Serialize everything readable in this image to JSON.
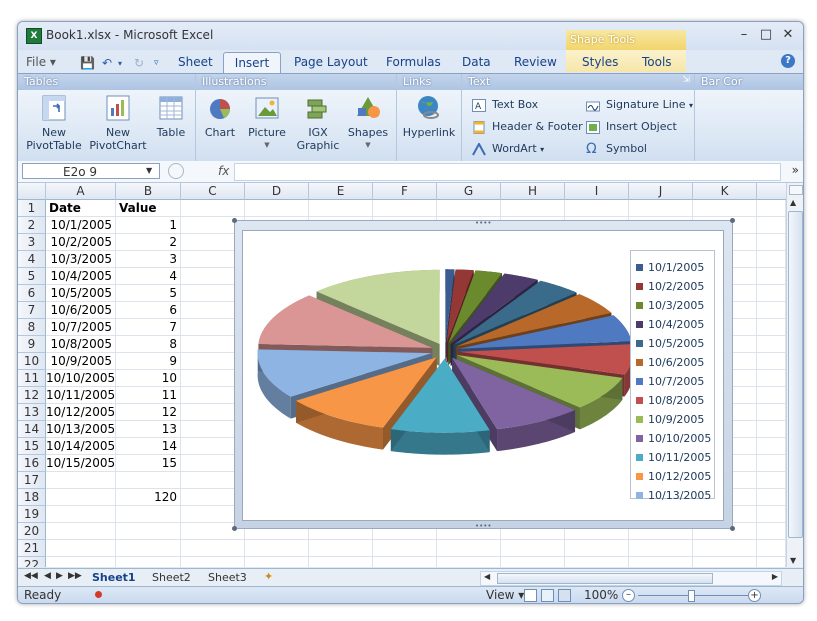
{
  "window": {
    "title": "Book1.xlsx - Microsoft Excel"
  },
  "context_tab_group": "Shape Tools",
  "tabs": [
    {
      "label": "File",
      "active": false
    },
    {
      "label": "Sheet",
      "active": false
    },
    {
      "label": "Insert",
      "active": true
    },
    {
      "label": "Page Layout",
      "active": false
    },
    {
      "label": "Formulas",
      "active": false
    },
    {
      "label": "Data",
      "active": false
    },
    {
      "label": "Review",
      "active": false
    },
    {
      "label": "Styles",
      "active": false
    },
    {
      "label": "Tools",
      "active": false
    }
  ],
  "ribbon": {
    "groups": {
      "tables": "Tables",
      "illustrations": "Illustrations",
      "links": "Links",
      "text": "Text",
      "bar_cor": "Bar Cor"
    },
    "buttons": {
      "new_pivottable": "New\nPivotTable",
      "new_pivotchart": "New\nPivotChart",
      "table": "Table",
      "chart": "Chart",
      "picture": "Picture",
      "igx_graphic": "IGX\nGraphic",
      "shapes": "Shapes",
      "hyperlink": "Hyperlink",
      "text_box": "Text Box",
      "header_footer": "Header & Footer",
      "wordart": "WordArt",
      "signature_line": "Signature Line",
      "insert_object": "Insert Object",
      "symbol": "Symbol"
    }
  },
  "formula_bar": {
    "name_box": "E2o 9",
    "fx": "fx",
    "formula": ""
  },
  "columns": [
    "A",
    "B",
    "C",
    "D",
    "E",
    "F",
    "G",
    "H",
    "I",
    "J",
    "K"
  ],
  "rows": [
    {
      "n": "1",
      "a": "Date",
      "b": "Value",
      "bold": true
    },
    {
      "n": "2",
      "a": "10/1/2005",
      "b": "1"
    },
    {
      "n": "3",
      "a": "10/2/2005",
      "b": "2"
    },
    {
      "n": "4",
      "a": "10/3/2005",
      "b": "3"
    },
    {
      "n": "5",
      "a": "10/4/2005",
      "b": "4"
    },
    {
      "n": "6",
      "a": "10/5/2005",
      "b": "5"
    },
    {
      "n": "7",
      "a": "10/6/2005",
      "b": "6"
    },
    {
      "n": "8",
      "a": "10/7/2005",
      "b": "7"
    },
    {
      "n": "9",
      "a": "10/8/2005",
      "b": "8"
    },
    {
      "n": "10",
      "a": "10/9/2005",
      "b": "9"
    },
    {
      "n": "11",
      "a": "10/10/2005",
      "b": "10"
    },
    {
      "n": "12",
      "a": "10/11/2005",
      "b": "11"
    },
    {
      "n": "13",
      "a": "10/12/2005",
      "b": "12"
    },
    {
      "n": "14",
      "a": "10/13/2005",
      "b": "13"
    },
    {
      "n": "15",
      "a": "10/14/2005",
      "b": "14"
    },
    {
      "n": "16",
      "a": "10/15/2005",
      "b": "15"
    },
    {
      "n": "17",
      "a": "",
      "b": ""
    },
    {
      "n": "18",
      "a": "",
      "b": "120"
    },
    {
      "n": "19",
      "a": "",
      "b": ""
    },
    {
      "n": "20",
      "a": "",
      "b": ""
    },
    {
      "n": "21",
      "a": "",
      "b": ""
    },
    {
      "n": "22",
      "a": "",
      "b": ""
    }
  ],
  "chart_data": {
    "type": "pie",
    "style": "3d-exploded",
    "categories": [
      "10/1/2005",
      "10/2/2005",
      "10/3/2005",
      "10/4/2005",
      "10/5/2005",
      "10/6/2005",
      "10/7/2005",
      "10/8/2005",
      "10/9/2005",
      "10/10/2005",
      "10/11/2005",
      "10/12/2005",
      "10/13/2005",
      "10/14/2005",
      "10/15/2005"
    ],
    "values": [
      1,
      2,
      3,
      4,
      5,
      6,
      7,
      8,
      9,
      10,
      11,
      12,
      13,
      14,
      15
    ],
    "colors": [
      "#3a5c8f",
      "#953735",
      "#6a8a2d",
      "#4d3b6b",
      "#3b6b8a",
      "#b8692a",
      "#4f79c0",
      "#c0504d",
      "#9bbb59",
      "#8064a2",
      "#4bacc6",
      "#f79646",
      "#8eb4e3",
      "#d99694",
      "#c3d69b"
    ],
    "legend_visible": [
      "10/1/2005",
      "10/2/2005",
      "10/3/2005",
      "10/4/2005",
      "10/5/2005",
      "10/6/2005",
      "10/7/2005",
      "10/8/2005",
      "10/9/2005",
      "10/10/2005",
      "10/11/2005",
      "10/12/2005",
      "10/13/2005"
    ],
    "legend_position": "right",
    "title": ""
  },
  "sheets": [
    {
      "label": "Sheet1",
      "active": true
    },
    {
      "label": "Sheet2",
      "active": false
    },
    {
      "label": "Sheet3",
      "active": false
    }
  ],
  "status": {
    "ready": "Ready",
    "view": "View",
    "zoom": "100%"
  }
}
